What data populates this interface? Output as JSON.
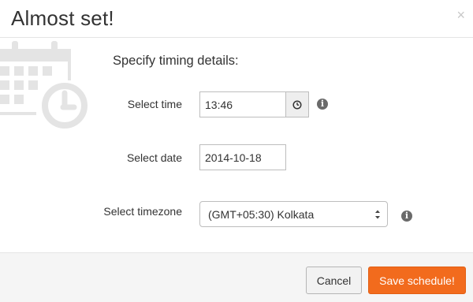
{
  "dialog": {
    "title": "Almost set!",
    "close_glyph": "×"
  },
  "illustration": {
    "icon": "calendar-clock-icon",
    "color": "#e4e4e4"
  },
  "form": {
    "heading": "Specify timing details:",
    "time": {
      "label": "Select time",
      "value": "13:46",
      "icon": "clock-icon"
    },
    "date": {
      "label": "Select date",
      "value": "2014-10-18"
    },
    "timezone": {
      "label": "Select timezone",
      "selected": "(GMT+05:30) Kolkata"
    },
    "info_glyph": "i"
  },
  "footer": {
    "cancel_label": "Cancel",
    "save_label": "Save schedule!"
  },
  "colors": {
    "accent": "#f26b1d",
    "footer_bg": "#f5f5f5",
    "info_icon": "#6a6a6a"
  }
}
